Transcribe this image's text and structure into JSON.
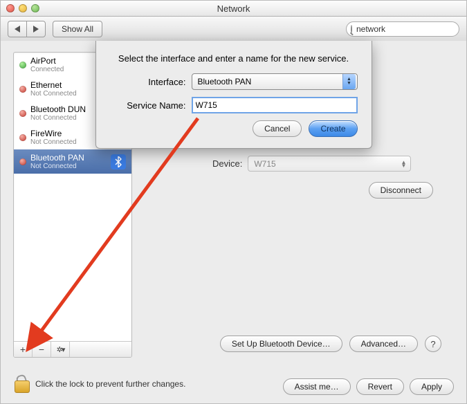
{
  "window": {
    "title": "Network"
  },
  "toolbar": {
    "show_all": "Show All",
    "search_value": "network"
  },
  "sidebar": {
    "items": [
      {
        "name": "AirPort",
        "status": "Connected",
        "status_color": "green",
        "icon": "wifi"
      },
      {
        "name": "Ethernet",
        "status": "Not Connected",
        "status_color": "red",
        "icon": "ethernet"
      },
      {
        "name": "Bluetooth DUN",
        "status": "Not Connected",
        "status_color": "red",
        "icon": "bluetooth"
      },
      {
        "name": "FireWire",
        "status": "Not Connected",
        "status_color": "red",
        "icon": "firewire"
      },
      {
        "name": "Bluetooth PAN",
        "status": "Not Connected",
        "status_color": "red",
        "icon": "bluetooth",
        "selected": true
      }
    ]
  },
  "detail": {
    "device_label": "Device:",
    "device_value": "W715",
    "disconnect": "Disconnect",
    "setup_bt": "Set Up Bluetooth Device…",
    "advanced": "Advanced…"
  },
  "lock": {
    "text": "Click the lock to prevent further changes."
  },
  "actions": {
    "assist": "Assist me…",
    "revert": "Revert",
    "apply": "Apply"
  },
  "sheet": {
    "message": "Select the interface and enter a name for the new service.",
    "interface_label": "Interface:",
    "interface_value": "Bluetooth PAN",
    "service_name_label": "Service Name:",
    "service_name_value": "W715",
    "cancel": "Cancel",
    "create": "Create"
  }
}
